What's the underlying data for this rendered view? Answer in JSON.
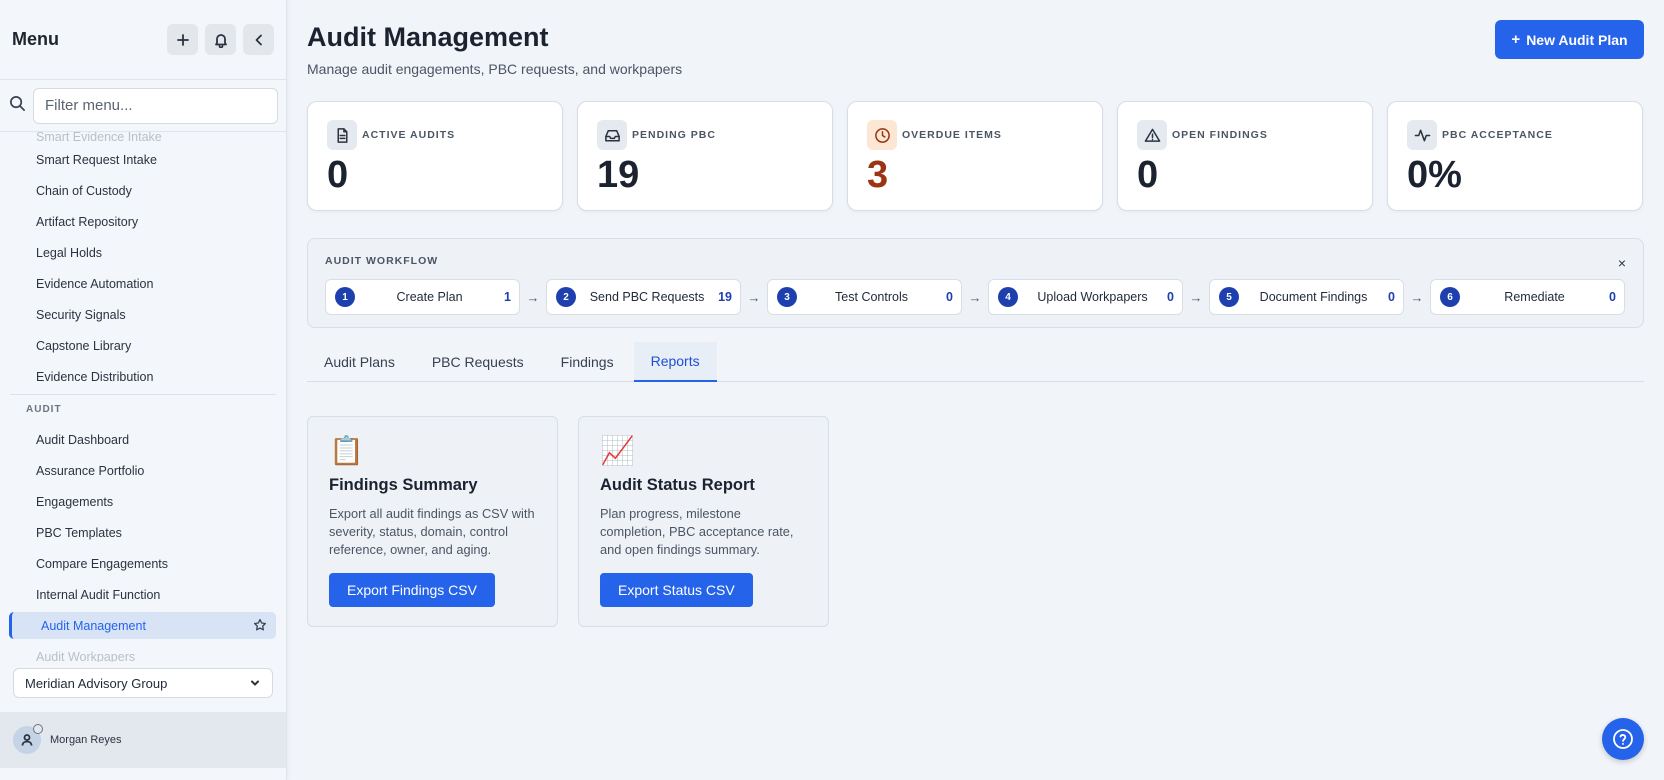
{
  "sidebar": {
    "title": "Menu",
    "search_placeholder": "Filter menu...",
    "items_top": [
      "Smart Evidence Intake",
      "Smart Request Intake",
      "Chain of Custody",
      "Artifact Repository",
      "Legal Holds",
      "Evidence Automation",
      "Security Signals",
      "Capstone Library",
      "Evidence Distribution"
    ],
    "section_audit": "AUDIT",
    "items_audit": [
      "Audit Dashboard",
      "Assurance Portfolio",
      "Engagements",
      "PBC Templates",
      "Compare Engagements",
      "Internal Audit Function"
    ],
    "active_item": "Audit Management",
    "next_item": "Audit Workpapers",
    "org": "Meridian Advisory Group",
    "user": "Morgan Reyes"
  },
  "header": {
    "title": "Audit Management",
    "subtitle": "Manage audit engagements, PBC requests, and workpapers",
    "new_plan": "New Audit Plan"
  },
  "stats": [
    {
      "label": "ACTIVE AUDITS",
      "value": "0",
      "icon": "document-icon"
    },
    {
      "label": "PENDING PBC",
      "value": "19",
      "icon": "inbox-icon"
    },
    {
      "label": "OVERDUE ITEMS",
      "value": "3",
      "icon": "clock-icon"
    },
    {
      "label": "OPEN FINDINGS",
      "value": "0",
      "icon": "warning-icon"
    },
    {
      "label": "PBC ACCEPTANCE",
      "value": "0%",
      "icon": "activity-icon"
    }
  ],
  "workflow": {
    "title": "AUDIT WORKFLOW",
    "close": "×",
    "steps": [
      {
        "num": "1",
        "name": "Create Plan",
        "count": "1"
      },
      {
        "num": "2",
        "name": "Send PBC Requests",
        "count": "19"
      },
      {
        "num": "3",
        "name": "Test Controls",
        "count": "0"
      },
      {
        "num": "4",
        "name": "Upload Workpapers",
        "count": "0"
      },
      {
        "num": "5",
        "name": "Document Findings",
        "count": "0"
      },
      {
        "num": "6",
        "name": "Remediate",
        "count": "0"
      }
    ],
    "arrow": "→"
  },
  "tabs": [
    "Audit Plans",
    "PBC Requests",
    "Findings",
    "Reports"
  ],
  "active_tab": "Reports",
  "reports": [
    {
      "icon": "📋",
      "title": "Findings Summary",
      "desc": "Export all audit findings as CSV with severity, status, domain, control reference, owner, and aging.",
      "button": "Export Findings CSV"
    },
    {
      "icon": "📈",
      "title": "Audit Status Report",
      "desc": "Plan progress, milestone completion, PBC acceptance rate, and open findings summary.",
      "button": "Export Status CSV"
    }
  ],
  "colors": {
    "accent": "#2563eb",
    "warning": "#9a3412",
    "active_bg": "#d8e4f6"
  }
}
